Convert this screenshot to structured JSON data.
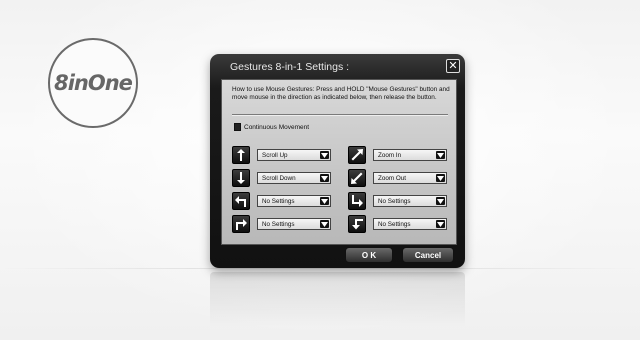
{
  "logo": {
    "text": "8inOne"
  },
  "window": {
    "title": "Gestures 8-in-1 Settings :",
    "close_glyph": "✕"
  },
  "instructions": "How to use Mouse Gestures: Press and HOLD \"Mouse Gestures\" button and move mouse in the direction as indicated below, then release the button.",
  "continuous_movement": {
    "label": "Continuous Movement",
    "checked": true
  },
  "gestures": [
    {
      "icon": "arrow-up-icon",
      "value": "Scroll Up"
    },
    {
      "icon": "arrow-down-icon",
      "value": "Scroll Down"
    },
    {
      "icon": "arrow-up-left-icon",
      "value": "No Settings"
    },
    {
      "icon": "arrow-down-right-icon",
      "value": "No Settings"
    },
    {
      "icon": "arrow-up-right-diag-icon",
      "value": "Zoom In"
    },
    {
      "icon": "arrow-down-left-diag-icon",
      "value": "Zoom Out"
    },
    {
      "icon": "arrow-down-right-turn-icon",
      "value": "No Settings"
    },
    {
      "icon": "arrow-left-down-turn-icon",
      "value": "No Settings"
    }
  ],
  "buttons": {
    "ok": "O K",
    "cancel": "Cancel"
  }
}
